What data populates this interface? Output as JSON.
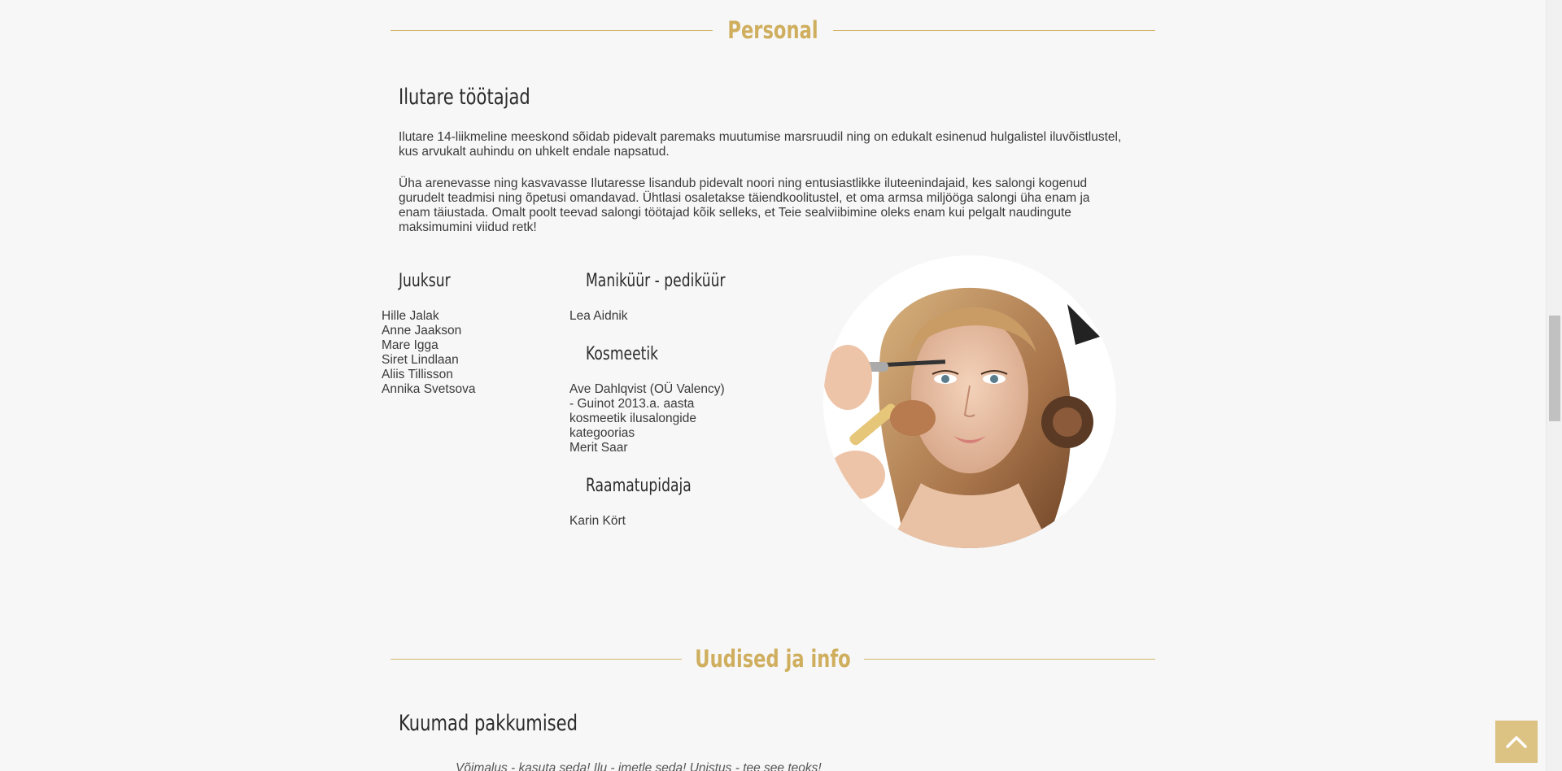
{
  "personal_section": {
    "title": "Personal",
    "heading": "Ilutare töötajad",
    "paragraph1": "Ilutare 14-liikmeline meeskond sõidab pidevalt paremaks muutumise marsruudil ning on edukalt esinenud hulgalistel iluvõistlustel, kus arvukalt auhindu on uhkelt endale napsatud.",
    "paragraph2": "Üha arenevasse ning kasvavasse Ilutaresse lisandub pidevalt noori ning entusiastlikke iluteenindajaid, kes salongi kogenud gurudelt teadmisi ning õpetusi omandavad. Ühtlasi osaletakse täiendkoolitustel, et oma armsa miljööga salongi üha enam ja enam täiustada. Omalt poolt teevad salongi töötajad kõik selleks, et Teie sealviibimine oleks enam kui pelgalt naudingute maksimumini viidud retk!",
    "hairdressers": {
      "title": "Juuksur",
      "names": [
        "Hille Jalak",
        "Anne Jaakson",
        "Mare Igga",
        "Siret Lindlaan",
        "Aliis Tillisson",
        "Annika Svetsova"
      ]
    },
    "manicure": {
      "title": "Maniküür - pediküür",
      "names": [
        "Lea Aidnik"
      ]
    },
    "cosmetician": {
      "title": "Kosmeetik",
      "lines": [
        "Ave Dahlqvist (OÜ Valency)",
        "- Guinot 2013.a. aasta",
        "kosmeetik ilusalongide",
        "kategoorias",
        "Merit Saar"
      ]
    },
    "accountant": {
      "title": "Raamatupidaja",
      "names": [
        "Karin Kört"
      ]
    }
  },
  "news_section": {
    "title": "Uudised ja info",
    "heading": "Kuumad pakkumised",
    "teaser": "Võimalus - kasuta seda! Ilu - imetle seda! Unistus - tee see teoks!"
  },
  "colors": {
    "accent_gold": "#cfae5e",
    "background": "#f7f7f7",
    "to_top_button": "#dcc283"
  },
  "icons": {
    "to_top": "chevron-up-icon",
    "photo": "woman-makeup-portrait"
  }
}
